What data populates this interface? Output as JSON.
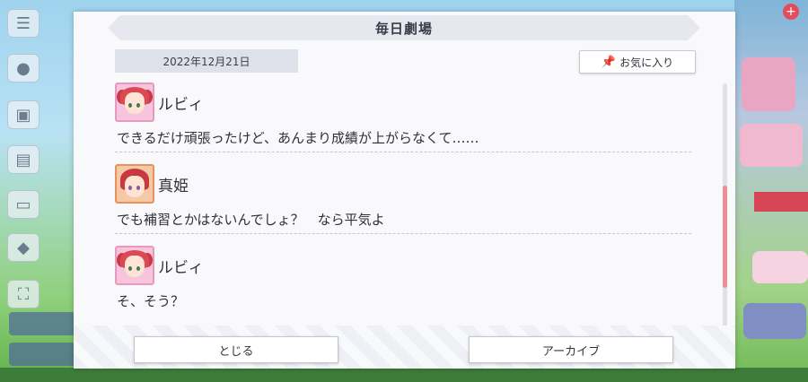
{
  "dialog": {
    "title": "毎日劇場",
    "date": "2022年12月21日",
    "favorite_label": "お気に入り",
    "favorite_icon": "pin-icon",
    "entries": [
      {
        "speaker": "ルビィ",
        "text": "できるだけ頑張ったけど、あんまり成績が上がらなくて……",
        "avatar": "ruby-avatar"
      },
      {
        "speaker": "真姫",
        "text": "でも補習とかはないんでしょ？　なら平気よ",
        "avatar": "maki-avatar"
      },
      {
        "speaker": "ルビィ",
        "text": "そ、そう？",
        "avatar": "ruby-avatar"
      }
    ],
    "close_label": "とじる",
    "archive_label": "アーカイブ"
  },
  "colors": {
    "accent_scroll": "#ee8c9a",
    "ruby_frame": "#e79ac0",
    "maki_frame": "#e7915c"
  }
}
